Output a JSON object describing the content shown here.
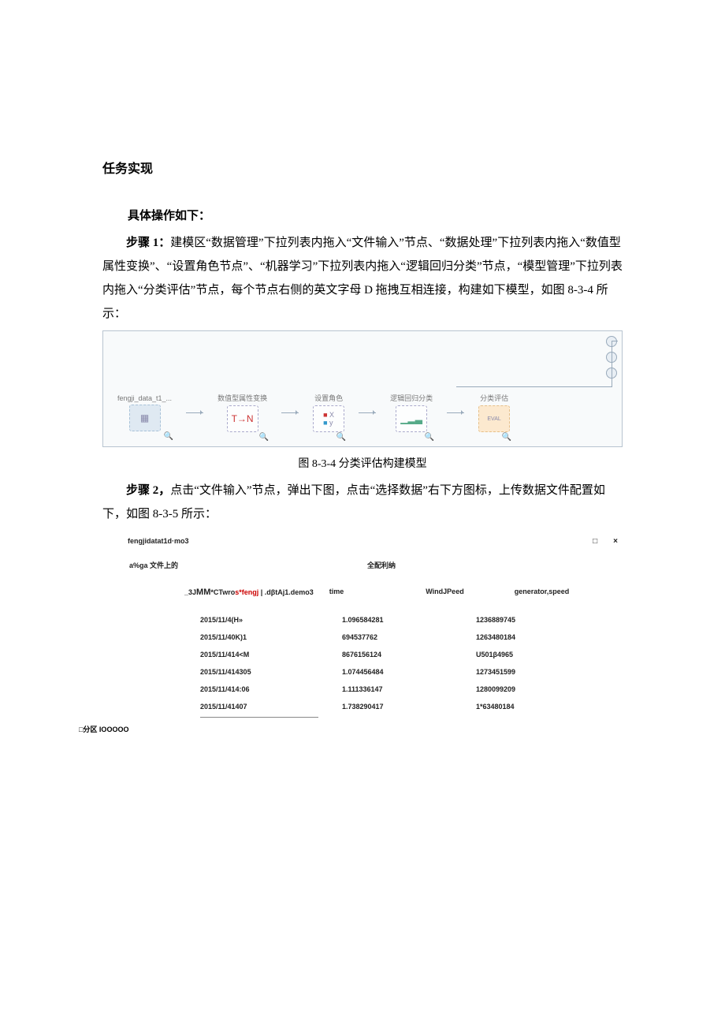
{
  "section_title": "任务实现",
  "sub_heading": "具体操作如下：",
  "step1_label": "步骤 1：",
  "step1_text_a": "建模区“数据管理”下拉列表内拖入“文件输入”节点、“数据处理”下拉列表内拖入“数值型属性变换”、“设置角色节点”、“机器学习”下拉列表内拖入“逻辑回归分类”节点，“模型管理”下拉列表内拖入“分类评估”节点，每个节点右侧的英文字母 D 拖拽互相连接，构建如下模型，如图 8-3-4 所示：",
  "diagram": {
    "node1": "fengji_data_t1_...",
    "node2": "数值型属性变换",
    "node3": "设置角色",
    "node4": "逻辑回归分类",
    "node5": "分类评估",
    "eval_label": "EVAL"
  },
  "fig834_caption": "图 8-3-4 分类评估构建模型",
  "step2_label": "步骤 2，",
  "step2_text": "点击“文件输入”节点，弹出下图，点击“选择数据”右下方图标，上传数据文件配置如下，如图 8-3-5 所示：",
  "data_window": {
    "title": "fengjidatat1d·mo3",
    "ctrl_min": "□",
    "ctrl_close": "×",
    "left_label": "a%ga 文件上的",
    "right_label": "全配利纳",
    "cols_line_a": "_3J",
    "cols_line_b": "MM",
    "cols_line_c": "*CTwro",
    "cols_line_d": "s*fengj",
    "cols_line_e": " | .dβtAj1.demo3",
    "col_time": "time",
    "col_wind": "WindJPeed",
    "col_gen": "generator,speed",
    "rows": [
      {
        "c1": "2015/11/4(H»",
        "c2": "1.096584281",
        "c3": "1236889745"
      },
      {
        "c1": "2015/11/40K)1",
        "c2": "694537762",
        "c3": "1263480184"
      },
      {
        "c1": "2015/11/414<M",
        "c2": "8676156124",
        "c3": "U501β4965"
      },
      {
        "c1": "2015/11/414305",
        "c2": "1.074456484",
        "c3": "1273451599"
      },
      {
        "c1": "2015/11/414:06",
        "c2": "1.111336147",
        "c3": "1280099209"
      },
      {
        "c1": "2015/11/41407",
        "c2": "1.738290417",
        "c3": "1*63480184"
      }
    ]
  },
  "partition_note": "□分区 IOOOOO"
}
